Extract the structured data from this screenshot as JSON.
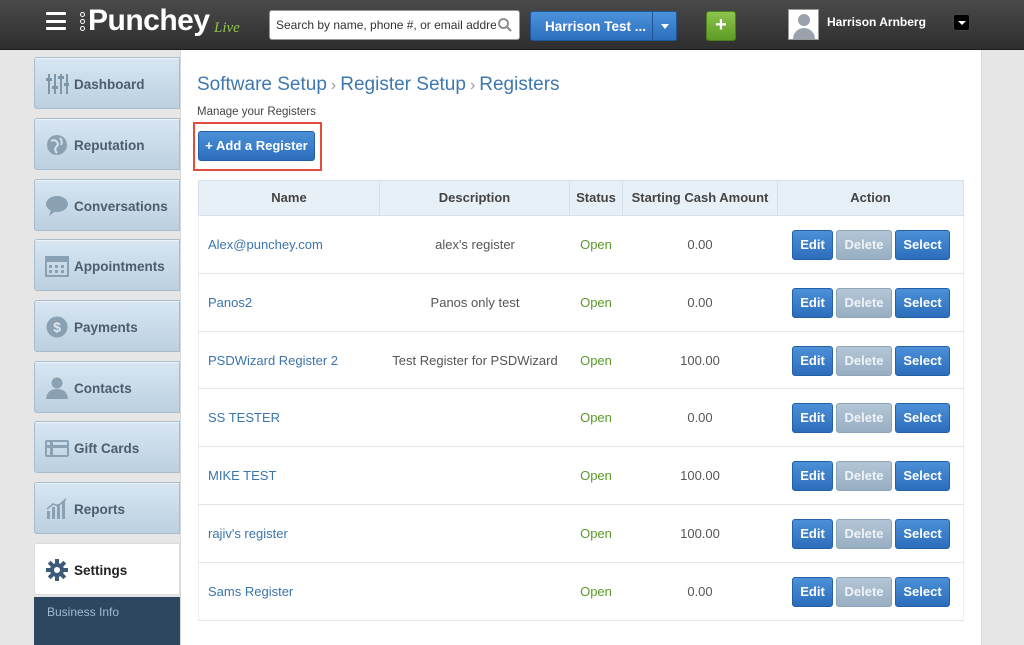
{
  "header": {
    "logo_text": "Punchey",
    "logo_badge": "Live",
    "search_placeholder": "Search by name, phone #, or email address",
    "business_name": "Harrison Test ...",
    "add_label": "+",
    "user_name": "Harrison Arnberg"
  },
  "sidebar": {
    "items": [
      {
        "label": "Dashboard",
        "icon": "sliders-icon"
      },
      {
        "label": "Reputation",
        "icon": "globe-icon"
      },
      {
        "label": "Conversations",
        "icon": "chat-bubble-icon"
      },
      {
        "label": "Appointments",
        "icon": "calendar-icon"
      },
      {
        "label": "Payments",
        "icon": "dollar-coin-icon"
      },
      {
        "label": "Contacts",
        "icon": "person-icon"
      },
      {
        "label": "Gift Cards",
        "icon": "gift-card-icon"
      },
      {
        "label": "Reports",
        "icon": "bar-chart-icon"
      },
      {
        "label": "Settings",
        "icon": "gear-icon"
      }
    ],
    "sub_items": [
      {
        "label": "Business Info"
      }
    ]
  },
  "main": {
    "breadcrumb": [
      "Software Setup",
      "Register Setup",
      "Registers"
    ],
    "subtitle": "Manage your Registers",
    "add_button": "+ Add a Register",
    "columns": [
      "Name",
      "Description",
      "Status",
      "Starting Cash Amount",
      "Action"
    ],
    "rows": [
      {
        "name": "Alex@punchey.com",
        "description": "alex's register",
        "status": "Open",
        "cash": "0.00"
      },
      {
        "name": "Panos2",
        "description": "Panos only test",
        "status": "Open",
        "cash": "0.00"
      },
      {
        "name": "PSDWizard Register 2",
        "description": "Test Register for PSDWizard",
        "status": "Open",
        "cash": "100.00"
      },
      {
        "name": "SS TESTER",
        "description": "",
        "status": "Open",
        "cash": "0.00"
      },
      {
        "name": "MIKE TEST",
        "description": "",
        "status": "Open",
        "cash": "100.00"
      },
      {
        "name": "rajiv's register",
        "description": "",
        "status": "Open",
        "cash": "100.00"
      },
      {
        "name": "Sams Register",
        "description": "",
        "status": "Open",
        "cash": "0.00"
      }
    ],
    "actions": {
      "edit": "Edit",
      "delete": "Delete",
      "select": "Select"
    }
  },
  "colors": {
    "accent": "#2c6dbb",
    "link": "#3a74ad",
    "status_open": "#5a9a2a",
    "highlight": "#e54b3c",
    "topbar": "#333333"
  }
}
